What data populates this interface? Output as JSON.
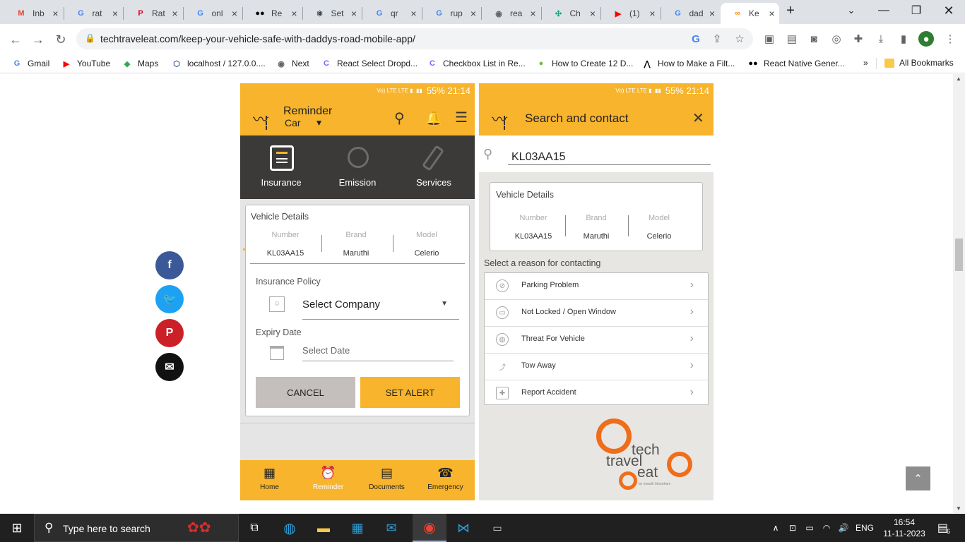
{
  "browser": {
    "tabs": [
      {
        "title": "Inb",
        "icon": "gmail-icon",
        "color": "#ea4335",
        "glyph": "M"
      },
      {
        "title": "rat",
        "icon": "google-icon",
        "color": "#4285f4",
        "glyph": "G"
      },
      {
        "title": "Rat",
        "icon": "pinterest-icon",
        "color": "#e60023",
        "glyph": "P"
      },
      {
        "title": "onl",
        "icon": "google-icon",
        "color": "#4285f4",
        "glyph": "G"
      },
      {
        "title": "Re",
        "icon": "medium-icon",
        "color": "#000000",
        "glyph": "●●"
      },
      {
        "title": "Set",
        "icon": "react-icon",
        "color": "#222f3e",
        "glyph": "⚛"
      },
      {
        "title": "qr",
        "icon": "google-icon",
        "color": "#4285f4",
        "glyph": "G"
      },
      {
        "title": "rup",
        "icon": "google-icon",
        "color": "#4285f4",
        "glyph": "G"
      },
      {
        "title": "rea",
        "icon": "globe-icon",
        "color": "#5f6368",
        "glyph": "◉"
      },
      {
        "title": "Ch",
        "icon": "chatgpt-icon",
        "color": "#10a37f",
        "glyph": "✣"
      },
      {
        "title": "(1)",
        "icon": "youtube-icon",
        "color": "#ff0000",
        "glyph": "▶"
      },
      {
        "title": "dad",
        "icon": "google-icon",
        "color": "#4285f4",
        "glyph": "G"
      },
      {
        "title": "Ke",
        "icon": "site-icon",
        "color": "#f7931e",
        "glyph": "∞"
      }
    ],
    "url": "techtraveleat.com/keep-your-vehicle-safe-with-daddys-road-mobile-app/",
    "bookmarks": [
      {
        "label": "Gmail",
        "icon": "google-icon",
        "color": "#4285f4",
        "glyph": "G"
      },
      {
        "label": "YouTube",
        "icon": "youtube-icon",
        "color": "#ff0000",
        "glyph": "▶"
      },
      {
        "label": "Maps",
        "icon": "maps-icon",
        "color": "#34a853",
        "glyph": "◆"
      },
      {
        "label": "localhost / 127.0.0....",
        "icon": "phpmyadmin-icon",
        "color": "#3b5998",
        "glyph": "⬡"
      },
      {
        "label": "Next",
        "icon": "globe-icon",
        "color": "#5f6368",
        "glyph": "◉"
      },
      {
        "label": "React Select Dropd...",
        "icon": "c-icon",
        "color": "#7b61ff",
        "glyph": "C"
      },
      {
        "label": "Checkbox List in Re...",
        "icon": "c-icon",
        "color": "#7b61ff",
        "glyph": "C"
      },
      {
        "label": "How to Create 12 D...",
        "icon": "leaf-icon",
        "color": "#7cb342",
        "glyph": "●"
      },
      {
        "label": "How to Make a Filt...",
        "icon": "codepen-icon",
        "color": "#000000",
        "glyph": "⋀"
      },
      {
        "label": "React Native Gener...",
        "icon": "medium-icon",
        "color": "#000000",
        "glyph": "●●"
      }
    ],
    "more_bookmarks": "»",
    "all_bookmarks": "All Bookmarks"
  },
  "app1": {
    "status": "55%  21:14",
    "title": "Reminder",
    "subtitle": "Car",
    "tabs": [
      "Insurance",
      "Emission",
      "Services"
    ],
    "card_title": "Vehicle Details",
    "cols": [
      {
        "head": "Number",
        "value": "KL03AA15"
      },
      {
        "head": "Brand",
        "value": "Maruthi"
      },
      {
        "head": "Model",
        "value": "Celerio"
      }
    ],
    "policy_label": "Insurance Policy",
    "company_value": "Select Company",
    "expiry_label": "Expiry Date",
    "date_placeholder": "Select Date",
    "cancel": "CANCEL",
    "set_alert": "SET ALERT",
    "nav": [
      {
        "label": "Home",
        "glyph": "▦"
      },
      {
        "label": "Reminder",
        "glyph": "⏰"
      },
      {
        "label": "Documents",
        "glyph": "▤"
      },
      {
        "label": "Emergency",
        "glyph": "☎"
      }
    ],
    "accent": "#f7b42c"
  },
  "app2": {
    "status": "55%  21:14",
    "title": "Search and contact",
    "search_value": "KL03AA15",
    "card_title": "Vehicle Details",
    "cols": [
      {
        "head": "Number",
        "value": "KL03AA15"
      },
      {
        "head": "Brand",
        "value": "Maruthi"
      },
      {
        "head": "Model",
        "value": "Celerio"
      }
    ],
    "reason_label": "Select a reason for contacting",
    "reasons": [
      "Parking Problem",
      "Not Locked / Open Window",
      "Threat For Vehicle",
      "Tow Away",
      "Report Accident"
    ],
    "logo": {
      "tech": "tech",
      "travel": "travel",
      "eat": "eat",
      "by": "by nisarth bhootham"
    }
  },
  "taskbar": {
    "search_placeholder": "Type here to search",
    "lang": "ENG",
    "time": "16:54",
    "date": "11-11-2023",
    "notif_count": "6"
  }
}
